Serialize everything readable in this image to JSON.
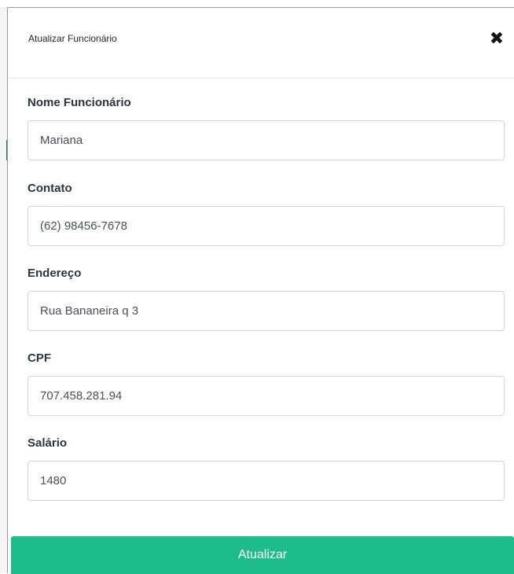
{
  "modal": {
    "title": "Atualizar Funcionário",
    "close_icon": "close-icon",
    "close_glyph": "✖"
  },
  "form": {
    "fields": [
      {
        "label": "Nome Funcionário",
        "value": "Mariana"
      },
      {
        "label": "Contato",
        "value": "(62) 98456-7678"
      },
      {
        "label": "Endereço",
        "value": "Rua Bananeira q 3"
      },
      {
        "label": "CPF",
        "value": "707.458.281.94"
      },
      {
        "label": "Salário",
        "value": "1480"
      }
    ],
    "submit_label": "Atualizar"
  },
  "colors": {
    "accent": "#1ebc8a",
    "label_text": "#2b3440",
    "input_border": "#cfd4d9"
  }
}
